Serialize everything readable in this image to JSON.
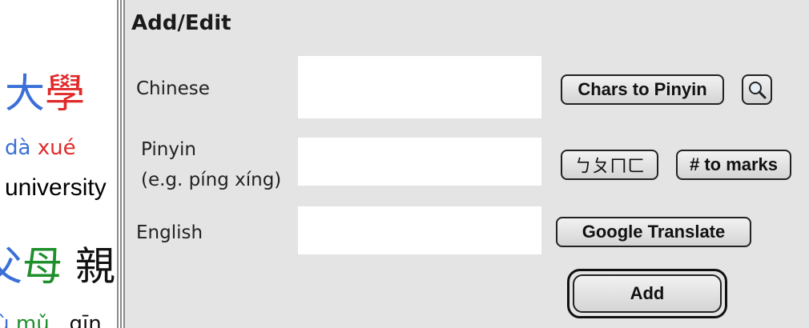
{
  "vocab": [
    {
      "characters": [
        {
          "char": "大",
          "color": "#3b6fd8"
        },
        {
          "char": "學",
          "color": "#e02a2a"
        }
      ],
      "pinyin": [
        {
          "syllable": "dà",
          "color": "#3b6fd8"
        },
        {
          "syllable": "xué",
          "color": "#e02a2a"
        }
      ],
      "english": "university"
    },
    {
      "characters": [
        {
          "char": "父",
          "color": "#3b6fd8"
        },
        {
          "char": "母",
          "color": "#1e8f2a"
        },
        {
          "char": "親",
          "color": "#111111"
        }
      ],
      "pinyin": [
        {
          "syllable": "fù",
          "color": "#3b6fd8"
        },
        {
          "syllable": "mǔ",
          "color": "#1e8f2a"
        },
        {
          "syllable": "qīn",
          "color": "#111111"
        }
      ]
    }
  ],
  "panel": {
    "title": "Add/Edit",
    "chinese_label": "Chinese",
    "pinyin_label": "Pinyin",
    "pinyin_example": "(e.g. píng xíng)",
    "english_label": "English",
    "chinese_value": "",
    "pinyin_value": "",
    "english_value": "",
    "chars_to_pinyin_label": "Chars to Pinyin",
    "lookup_icon": "magnifier-icon",
    "zhuyin_label": "ㄅㄆㄇㄈ",
    "to_marks_label": "# to marks",
    "google_translate_label": "Google Translate",
    "add_label": "Add"
  }
}
